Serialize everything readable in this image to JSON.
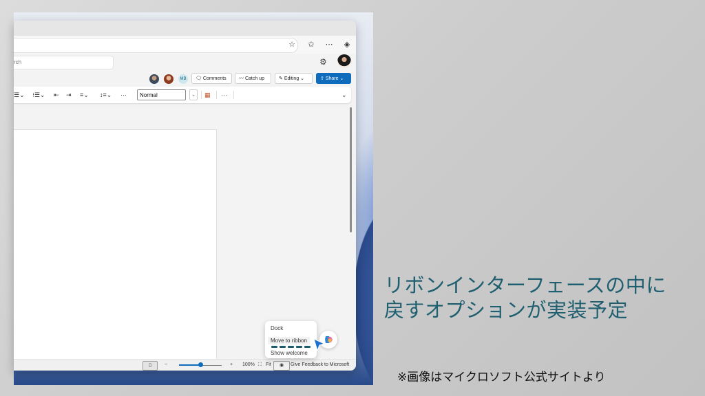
{
  "addressbar": {
    "icons": [
      "favorite-add-icon",
      "favorites-icon",
      "more-icon",
      "copilot-edge-icon"
    ]
  },
  "header": {
    "search_placeholder": "rch"
  },
  "collab": {
    "avatar_initials": "MB",
    "comments_label": "Comments",
    "catchup_label": "Catch up",
    "editing_label": "Editing",
    "share_label": "Share"
  },
  "ribbon": {
    "style_value": "Normal",
    "more_glyph": "···"
  },
  "status": {
    "zoom_level": "100%",
    "fit_label": "Fit",
    "feedback_label": "Give Feedback to Microsoft",
    "zoom_minus": "−",
    "zoom_plus": "+",
    "zoom_fraction": 0.5
  },
  "popup": {
    "items": [
      "Dock",
      "Move to ribbon",
      "Show welcome"
    ]
  },
  "caption": {
    "line1": "リボンインターフェースの中に",
    "line2": "戻すオプションが実装予定"
  },
  "note": "※画像はマイクロソフト公式サイトより",
  "colors": {
    "accent": "#0f6cbd",
    "caption": "#1f5f70"
  }
}
